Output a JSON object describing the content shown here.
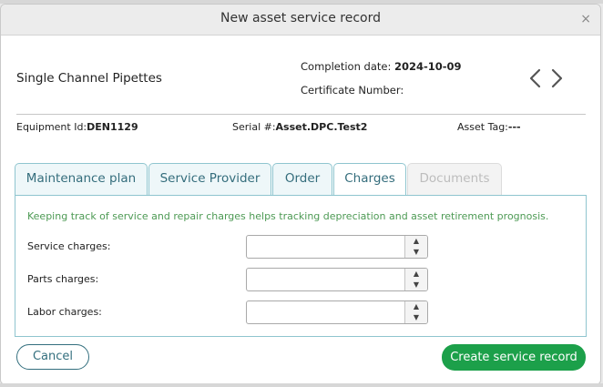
{
  "dialog": {
    "title": "New asset service record",
    "close_glyph": "×"
  },
  "asset": {
    "name": "Single Channel Pipettes",
    "completion_label": "Completion date: ",
    "completion_value": "2024-10-09",
    "certificate_label": "Certificate Number:",
    "certificate_value": ""
  },
  "info": {
    "equipment_label": "Equipment Id:",
    "equipment_value": "DEN1129",
    "serial_label": "Serial #:",
    "serial_value": "Asset.DPC.Test2",
    "tag_label": "Asset Tag:",
    "tag_value": "---"
  },
  "tabs": [
    {
      "label": "Maintenance plan"
    },
    {
      "label": "Service Provider"
    },
    {
      "label": "Order"
    },
    {
      "label": "Charges"
    },
    {
      "label": "Documents"
    }
  ],
  "active_tab": "Charges",
  "charges": {
    "hint": "Keeping track of service and repair charges helps tracking depreciation and asset retirement prognosis.",
    "fields": [
      {
        "label": "Service charges:",
        "value": ""
      },
      {
        "label": "Parts charges:",
        "value": ""
      },
      {
        "label": "Labor charges:",
        "value": ""
      }
    ]
  },
  "footer": {
    "cancel_label": "Cancel",
    "create_label": "Create service record"
  },
  "colors": {
    "accent_teal": "#346d7c",
    "tab_border": "#8fc5cf",
    "hint_green": "#4d9a54",
    "primary_button": "#1ca04a"
  }
}
